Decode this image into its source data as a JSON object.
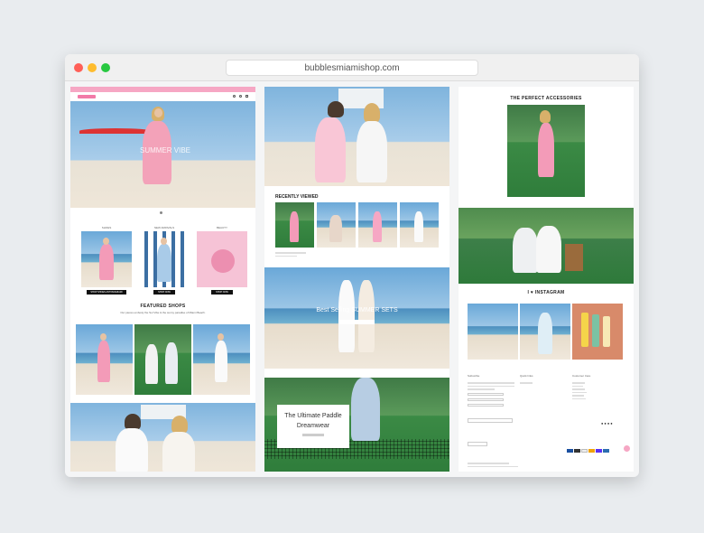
{
  "browser": {
    "url": "bubblesmiamishop.com"
  },
  "col1": {
    "hero_text": "SUMMER VIBE",
    "promo_labels": [
      "SHOES",
      "NEW ARRIVALS",
      "BEAUTY"
    ],
    "promo_buttons": [
      "SHOP SHOES ANTONIAMIAMI",
      "SHOP NOW",
      "SHOP NOW"
    ],
    "featured_title": "FEATURED SHOPS",
    "featured_sub": "Our pieces embody the Sol Vibe & the sunny paradise of Miami Beach."
  },
  "col2": {
    "recently_viewed_title": "RECENTLY VIEWED",
    "best_selling": "Best Selling SUMMER SETS",
    "paddle_title": "The Ultimate Paddle Dreamwear"
  },
  "col3": {
    "accessories_title": "THE PERFECT ACCESSORIES",
    "instagram_title": "I ♥ INSTAGRAM",
    "footer_headings": [
      "Subscribe",
      "Quick links",
      "Customer Care"
    ]
  },
  "colors": {
    "brand_pink": "#f6a7c4",
    "accent_dark": "#111111"
  }
}
